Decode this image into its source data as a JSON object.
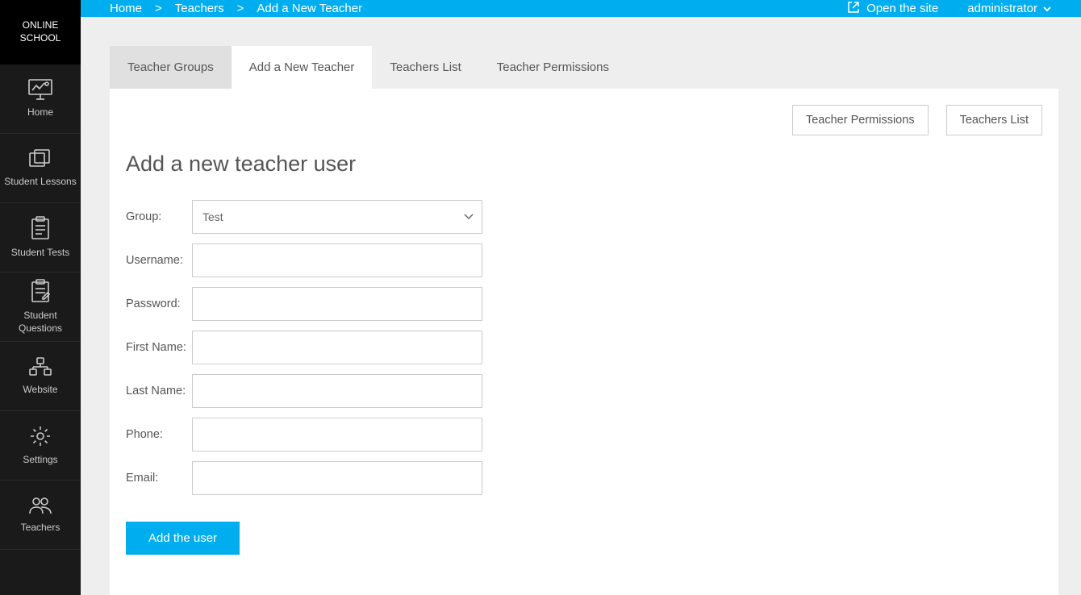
{
  "sidebar": {
    "logo": "ONLINE\nSCHOOL",
    "items": [
      {
        "label": "Home"
      },
      {
        "label": "Student Lessons"
      },
      {
        "label": "Student Tests"
      },
      {
        "label": "Student Questions"
      },
      {
        "label": "Website"
      },
      {
        "label": "Settings"
      },
      {
        "label": "Teachers"
      }
    ]
  },
  "header": {
    "breadcrumb": [
      "Home",
      "Teachers",
      "Add a New Teacher"
    ],
    "sep": ">",
    "open_site": "Open the site",
    "user": "administrator"
  },
  "tabs": [
    {
      "label": "Teacher Groups",
      "active": false
    },
    {
      "label": "Add a New Teacher",
      "active": true
    },
    {
      "label": "Teachers List",
      "active": false
    },
    {
      "label": "Teacher Permissions",
      "active": false
    }
  ],
  "panel": {
    "actions": [
      "Teacher Permissions",
      "Teachers List"
    ],
    "title": "Add a new teacher user",
    "form": {
      "group": {
        "label": "Group:",
        "value": "Test"
      },
      "username": {
        "label": "Username:",
        "value": ""
      },
      "password": {
        "label": "Password:",
        "value": ""
      },
      "first_name": {
        "label": "First Name:",
        "value": ""
      },
      "last_name": {
        "label": "Last Name:",
        "value": ""
      },
      "phone": {
        "label": "Phone:",
        "value": ""
      },
      "email": {
        "label": "Email:",
        "value": ""
      },
      "submit": "Add the user"
    }
  }
}
